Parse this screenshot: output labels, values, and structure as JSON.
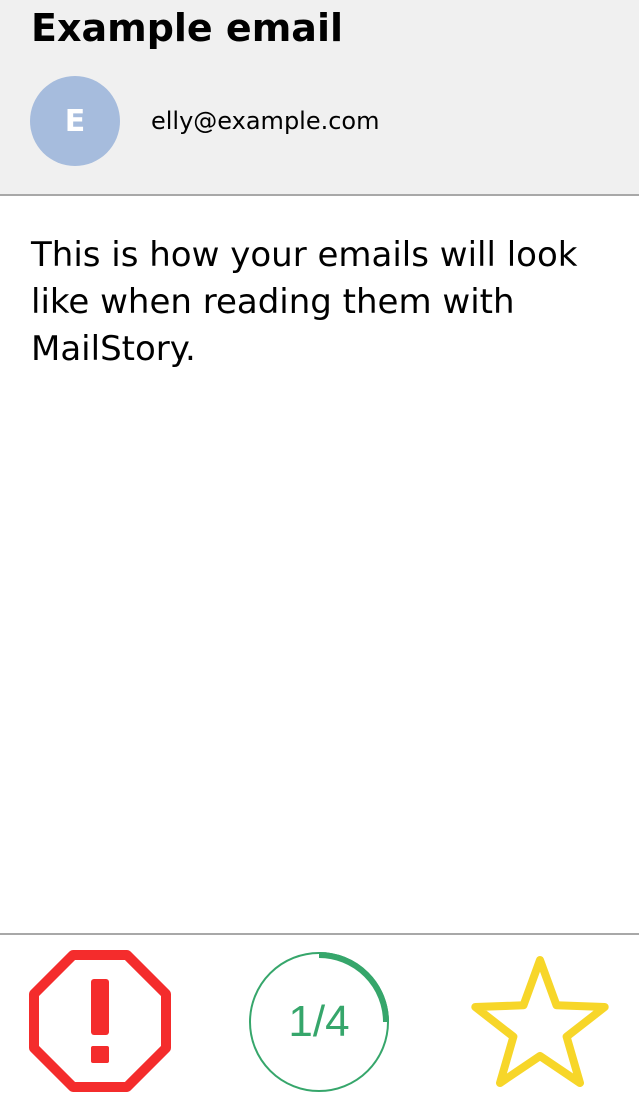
{
  "email": {
    "subject": "Example email",
    "avatar_initial": "E",
    "sender": "elly@example.com",
    "body": "This is how your emails will look like when reading them with MailStory."
  },
  "footer": {
    "spam_icon": "octagon-exclamation-icon",
    "progress": {
      "current": 1,
      "total": 4,
      "label": "1/4",
      "fraction": 0.25
    },
    "star_icon": "star-outline-icon"
  },
  "colors": {
    "header_bg": "#f0f0f0",
    "divider": "#a8a8a8",
    "avatar_bg": "#a6bcdd",
    "spam_red": "#f42c2c",
    "progress_green": "#36a66b",
    "star_yellow": "#f7d629"
  }
}
